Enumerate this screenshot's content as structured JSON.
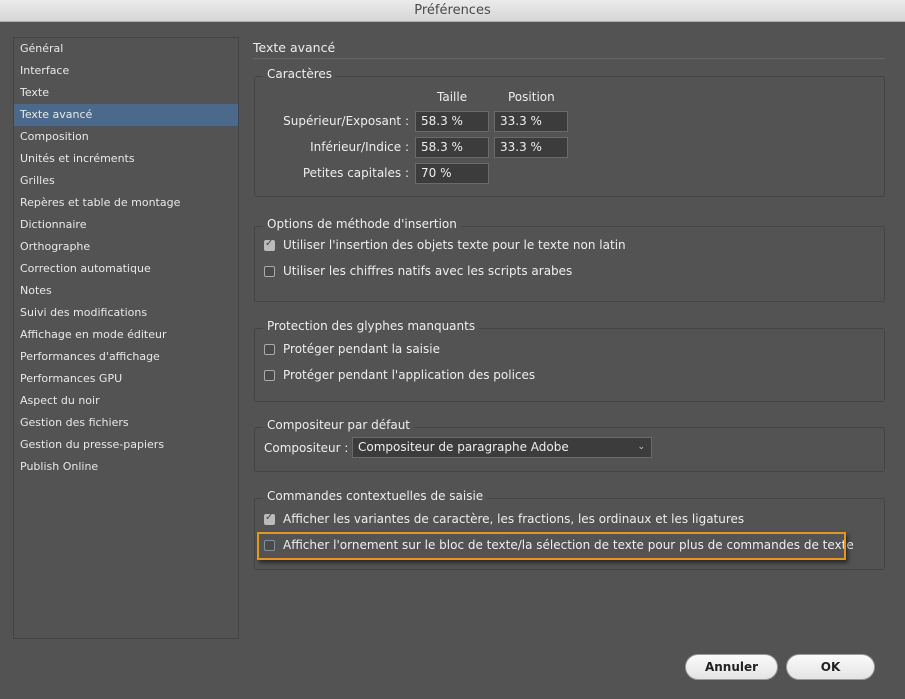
{
  "window": {
    "title": "Préférences"
  },
  "sidebar": {
    "items": [
      {
        "label": "Général"
      },
      {
        "label": "Interface"
      },
      {
        "label": "Texte"
      },
      {
        "label": "Texte avancé",
        "selected": true
      },
      {
        "label": "Composition"
      },
      {
        "label": "Unités et incréments"
      },
      {
        "label": "Grilles"
      },
      {
        "label": "Repères et table de montage"
      },
      {
        "label": "Dictionnaire"
      },
      {
        "label": "Orthographe"
      },
      {
        "label": "Correction automatique"
      },
      {
        "label": "Notes"
      },
      {
        "label": "Suivi des modifications"
      },
      {
        "label": "Affichage en mode éditeur"
      },
      {
        "label": "Performances d'affichage"
      },
      {
        "label": "Performances GPU"
      },
      {
        "label": "Aspect du noir"
      },
      {
        "label": "Gestion des fichiers"
      },
      {
        "label": "Gestion du presse-papiers"
      },
      {
        "label": "Publish Online"
      }
    ]
  },
  "main": {
    "heading": "Texte avancé",
    "caracteres": {
      "title": "Caractères",
      "col_taille": "Taille",
      "col_position": "Position",
      "sup_label": "Supérieur/Exposant :",
      "sup_taille": "58.3 %",
      "sup_position": "33.3 %",
      "inf_label": "Inférieur/Indice :",
      "inf_taille": "58.3 %",
      "inf_position": "33.3 %",
      "pc_label": "Petites capitales :",
      "pc_taille": "70 %"
    },
    "insertion": {
      "title": "Options de méthode d'insertion",
      "opt1": "Utiliser l'insertion des objets texte pour le texte non latin",
      "opt1_checked": true,
      "opt2": "Utiliser les chiffres natifs avec les scripts arabes",
      "opt2_checked": false
    },
    "glyphes": {
      "title": "Protection des glyphes manquants",
      "opt1": "Protéger pendant la saisie",
      "opt1_checked": false,
      "opt2": "Protéger pendant l'application des polices",
      "opt2_checked": false
    },
    "compositeur": {
      "title": "Compositeur par défaut",
      "label": "Compositeur :",
      "value": "Compositeur de paragraphe Adobe"
    },
    "commandes": {
      "title": "Commandes contextuelles de saisie",
      "opt1": "Afficher les variantes de caractère, les fractions, les ordinaux et les ligatures",
      "opt1_checked": true,
      "opt2": "Afficher l'ornement sur le bloc de texte/la sélection de texte pour plus de commandes de texte",
      "opt2_checked": false
    },
    "highlight_color": "#e8951f"
  },
  "buttons": {
    "cancel": "Annuler",
    "ok": "OK"
  }
}
